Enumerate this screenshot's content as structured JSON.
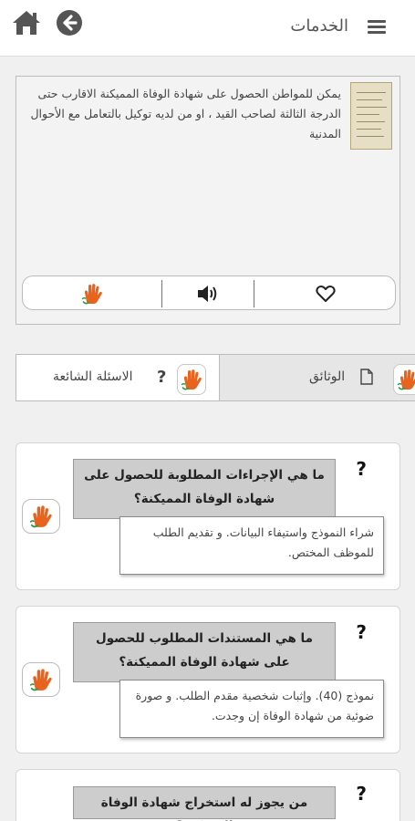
{
  "header": {
    "title": "الخدمات",
    "home_icon": "home-icon",
    "back_icon": "arrow-left-circle-icon",
    "menu_icon": "hamburger-menu-icon"
  },
  "service": {
    "description": "يمكن للمواطن الحصول على شهادة الوفاة المميكنة الاقارب حتى الدرجة الثالثة لصاحب القيد ، او من لديه توكيل بالتعامل مع الأحوال المدنية",
    "actions": [
      "sign-language-icon",
      "speaker-icon",
      "heart-icon"
    ]
  },
  "tabs": {
    "faq_label": "الاسئلة الشائعة",
    "docs_label": "الوثائق",
    "active": "docs"
  },
  "faq": [
    {
      "question": "ما هي الإجراءات المطلوبة للحصول على شهادة الوفاة المميكنة؟",
      "answer": "شراء النموذج واستيفاء البيانات. و تقديم الطلب للموظف المختص."
    },
    {
      "question": "ما هي المستندات المطلوب للحصول على شهادة الوفاة المميكنة؟",
      "answer": "نموذج (40). وإثبات شخصية مقدم الطلب. و صورة ضوئية من شهادة الوفاة إن وجدت."
    },
    {
      "question": "من يجوز له استخراج شهادة الوفاة المميكنة؟",
      "answer": ""
    }
  ],
  "colors": {
    "sign_orange": "#e8641e",
    "sign_green": "#2e9a47",
    "icon_gray": "#555555"
  }
}
